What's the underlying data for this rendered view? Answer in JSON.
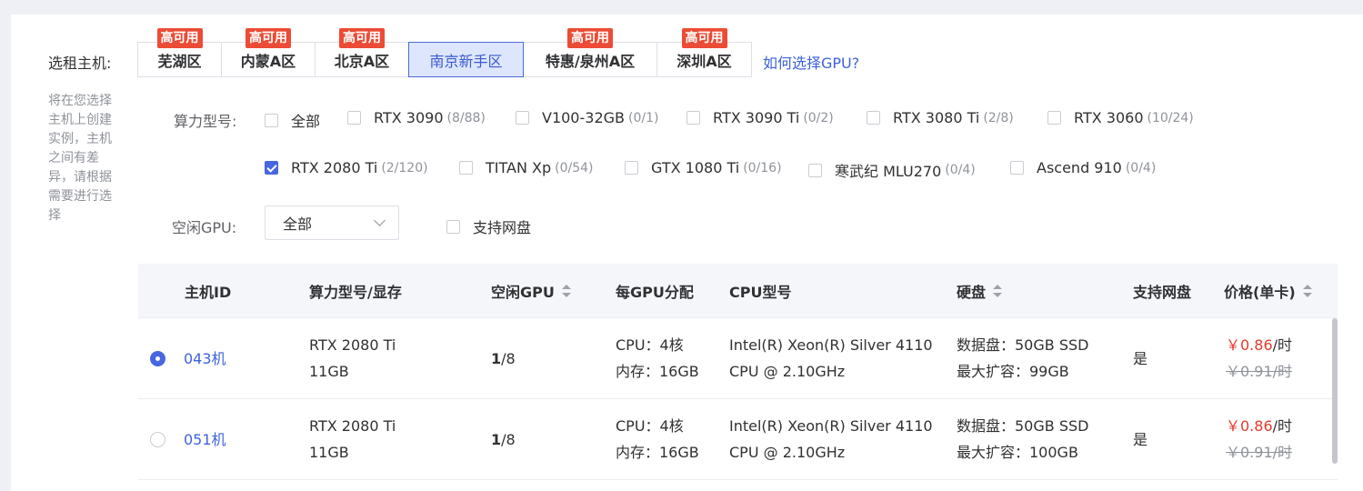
{
  "host_select_label": "选租主机:",
  "hint": "将在您选择主机上创建实例，主机之间有差异，请根据需要进行选择",
  "regions": [
    {
      "name": "芜湖区",
      "badge": "高可用"
    },
    {
      "name": "内蒙A区",
      "badge": "高可用"
    },
    {
      "name": "北京A区",
      "badge": "高可用"
    },
    {
      "name": "南京新手区",
      "badge": "",
      "active": true
    },
    {
      "name": "特惠/泉州A区",
      "badge": "高可用"
    },
    {
      "name": "深圳A区",
      "badge": "高可用"
    }
  ],
  "help_link": "如何选择GPU?",
  "gpu_type_label": "算力型号:",
  "gpu_types": [
    {
      "name": "全部",
      "count": "",
      "checked": false
    },
    {
      "name": "RTX 3090",
      "count": "(8/88)",
      "checked": false
    },
    {
      "name": "V100-32GB",
      "count": "(0/1)",
      "checked": false
    },
    {
      "name": "RTX 3090 Ti",
      "count": "(0/2)",
      "checked": false
    },
    {
      "name": "RTX 3080 Ti",
      "count": "(2/8)",
      "checked": false
    },
    {
      "name": "RTX 3060",
      "count": "(10/24)",
      "checked": false
    },
    {
      "name": "RTX 2080 Ti",
      "count": "(2/120)",
      "checked": true
    },
    {
      "name": "TITAN Xp",
      "count": "(0/54)",
      "checked": false
    },
    {
      "name": "GTX 1080 Ti",
      "count": "(0/16)",
      "checked": false
    },
    {
      "name": "寒武纪 MLU270",
      "count": "(0/4)",
      "checked": false
    },
    {
      "name": "Ascend 910",
      "count": "(0/4)",
      "checked": false
    }
  ],
  "idle_gpu_label": "空闲GPU:",
  "idle_gpu_value": "全部",
  "netdisk_label": "支持网盘",
  "table": {
    "headers": [
      "主机ID",
      "算力型号/显存",
      "空闲GPU",
      "每GPU分配",
      "CPU型号",
      "硬盘",
      "支持网盘",
      "价格(单卡)"
    ],
    "rows": [
      {
        "id": "043机",
        "selected": true,
        "gpu_model": "RTX 2080 Ti",
        "vram": "11GB",
        "idle_free": "1",
        "idle_total": "/8",
        "alloc_cpu": "CPU：4核",
        "alloc_mem": "内存：16GB",
        "cpu_line1": "Intel(R) Xeon(R) Silver 4110",
        "cpu_line2": "CPU @ 2.10GHz",
        "disk_line1": "数据盘：50GB SSD",
        "disk_line2": "最大扩容：99GB",
        "netdisk": "是",
        "price": "￥0.86",
        "price_unit": "/时",
        "orig_price": "￥0.91/时"
      },
      {
        "id": "051机",
        "selected": false,
        "gpu_model": "RTX 2080 Ti",
        "vram": "11GB",
        "idle_free": "1",
        "idle_total": "/8",
        "alloc_cpu": "CPU：4核",
        "alloc_mem": "内存：16GB",
        "cpu_line1": "Intel(R) Xeon(R) Silver 4110",
        "cpu_line2": "CPU @ 2.10GHz",
        "disk_line1": "数据盘：50GB SSD",
        "disk_line2": "最大扩容：100GB",
        "netdisk": "是",
        "price": "￥0.86",
        "price_unit": "/时",
        "orig_price": "￥0.91/时"
      }
    ]
  }
}
